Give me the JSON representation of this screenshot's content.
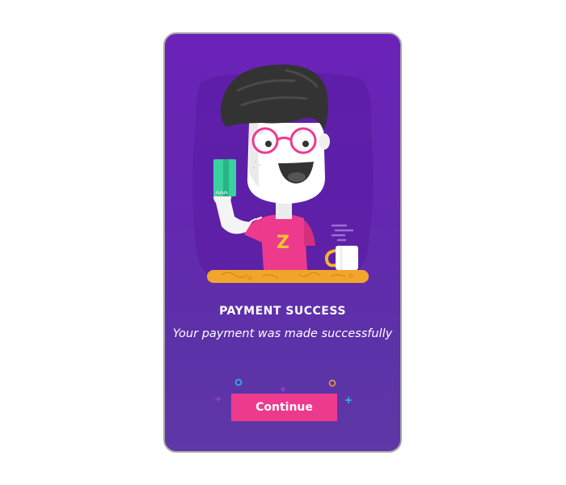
{
  "success_screen": {
    "title": "PAYMENT SUCCESS",
    "message": "Your payment was made successfully",
    "continue_label": "Continue",
    "shirt_logo": "Z"
  },
  "colors": {
    "card_background": "#6422b5",
    "button": "#ee3a8d",
    "glasses": "#ee3a8d",
    "shirt": "#ee3a8d",
    "table": "#f2a52c",
    "card_in_hand": "#3ad1a0",
    "mug_handle": "#f2b531"
  },
  "icons": {
    "illustration": "man-holding-card-illustration",
    "decorations": [
      "circle-icon",
      "plus-icon"
    ]
  }
}
